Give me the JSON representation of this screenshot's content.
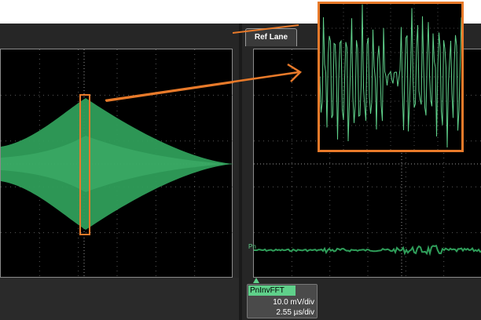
{
  "panels": {
    "right_tab_label": "Ref Lane"
  },
  "channel": {
    "marker_label": "Pn",
    "trace_name": "PnInvFFT",
    "vertical_scale": "10.0 mV/div",
    "time_scale": "2.55 µs/div"
  },
  "colors": {
    "trace": "#2f9e5a",
    "trace_light": "#5fd08a",
    "highlight": "#e87a2a",
    "grid": "#8a8a8a"
  }
}
